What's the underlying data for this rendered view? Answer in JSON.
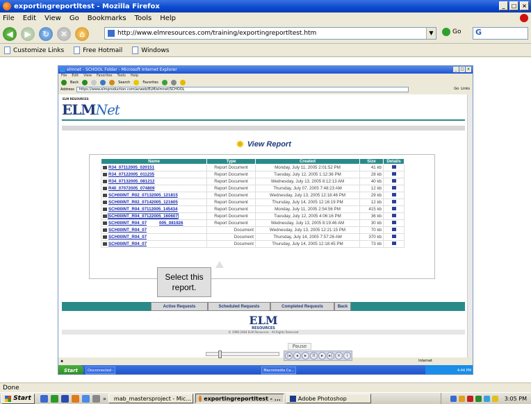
{
  "firefox": {
    "title": "exportingreportltest - Mozilla Firefox",
    "menu": [
      "File",
      "Edit",
      "View",
      "Go",
      "Bookmarks",
      "Tools",
      "Help"
    ],
    "url": "http://www.elmresources.com/training/exportingreportltest.htm",
    "go_label": "Go",
    "search_text": "G",
    "bookmarks": [
      "Customize Links",
      "Free Hotmail",
      "Windows"
    ],
    "status": "Done"
  },
  "ie": {
    "title": "elmnet - SCHOOL Folder - Microsoft Internet Explorer",
    "menu": [
      "File",
      "Edit",
      "View",
      "Favorites",
      "Tools",
      "Help"
    ],
    "toolbar": [
      "Back",
      "Search",
      "Favorites"
    ],
    "address_label": "Address",
    "address": "https://www.elmproduction.com/acweb/ELM/elmnet/SCHOOL",
    "go_label": "Go",
    "links_label": "Links",
    "status_zone": "Internet",
    "taskbar": {
      "start": "Start",
      "items": [
        "Disconnected -",
        "Macromedia Ca..."
      ],
      "clock": "4:44 PM"
    }
  },
  "page": {
    "logo_small": "ELM RESOURCES",
    "logo_main": "ELM",
    "logo_net": "Net",
    "heading": "View Report",
    "columns": [
      "Name",
      "Type",
      "Created",
      "Size",
      "Details"
    ],
    "rows": [
      {
        "name": "R34_07112005_020151",
        "type": "Report Document",
        "created": "Monday, July 11, 2005 2:01:52 PM",
        "size": "41 kb"
      },
      {
        "name": "R34_07122005_011235",
        "type": "Report Document",
        "created": "Tuesday, July 12, 2005 1:12:36 PM",
        "size": "28 kb"
      },
      {
        "name": "R34_07132005_081212",
        "type": "Report Document",
        "created": "Wednesday, July 13, 2005 8:12:13 AM",
        "size": "40 kb"
      },
      {
        "name": "R40_07072005_074809",
        "type": "Report Document",
        "created": "Thursday, July 07, 2005 7:48:23 AM",
        "size": "12 kb"
      },
      {
        "name": "SCH00INT_R02_07132005_121815",
        "type": "Report Document",
        "created": "Wednesday, July 13, 2005 12:18:46 PM",
        "size": "29 kb"
      },
      {
        "name": "SCH00INT_R02_07142005_121605",
        "type": "Report Document",
        "created": "Thursday, July 14, 2005 12:16:19 PM",
        "size": "12 kb"
      },
      {
        "name": "SCH00INT_R04_07112005_145434",
        "type": "Report Document",
        "created": "Monday, July 11, 2005 2:54:56 PM",
        "size": "415 kb"
      },
      {
        "name": "SCH00INT_R04_07122005_160607",
        "type": "Report Document",
        "created": "Tuesday, July 12, 2005 4:06:16 PM",
        "size": "36 kb"
      },
      {
        "name": "SCH00INT_R04_07",
        "name_tail": "005_081926",
        "type": "Report Document",
        "created": "Wednesday, July 13, 2005 8:19:46 AM",
        "size": "30 kb"
      },
      {
        "name": "SCH00INT_R04_07",
        "type": "Document",
        "created": "Wednesday, July 13, 2005 12:21:15 PM",
        "size": "70 kb"
      },
      {
        "name": "SCH00INT_R04_07",
        "type": "Document",
        "created": "Thursday, July 14, 2005 7:57:26 AM",
        "size": "370 kb"
      },
      {
        "name": "SCH00INT_R04_07",
        "type": "Document",
        "created": "Thursday, July 14, 2005 12:18:45 PM",
        "size": "73 kb"
      }
    ],
    "callout_line1": "Select this",
    "callout_line2": "report.",
    "request_tabs": [
      "Active Requests",
      "Scheduled Requests",
      "Completed Requests",
      "Back"
    ],
    "footer_logo": "ELM",
    "footer_resources": "RESOURCES",
    "copyright": "© 1996-2004 ELM Resources - All Rights Reserved"
  },
  "player": {
    "pause_label": "Pause"
  },
  "taskbar": {
    "start": "Start",
    "items": [
      "mab_mastersproject - Mic...",
      "exportingreportltest - ...",
      "Adobe Photoshop"
    ],
    "clock": "3:05 PM"
  }
}
